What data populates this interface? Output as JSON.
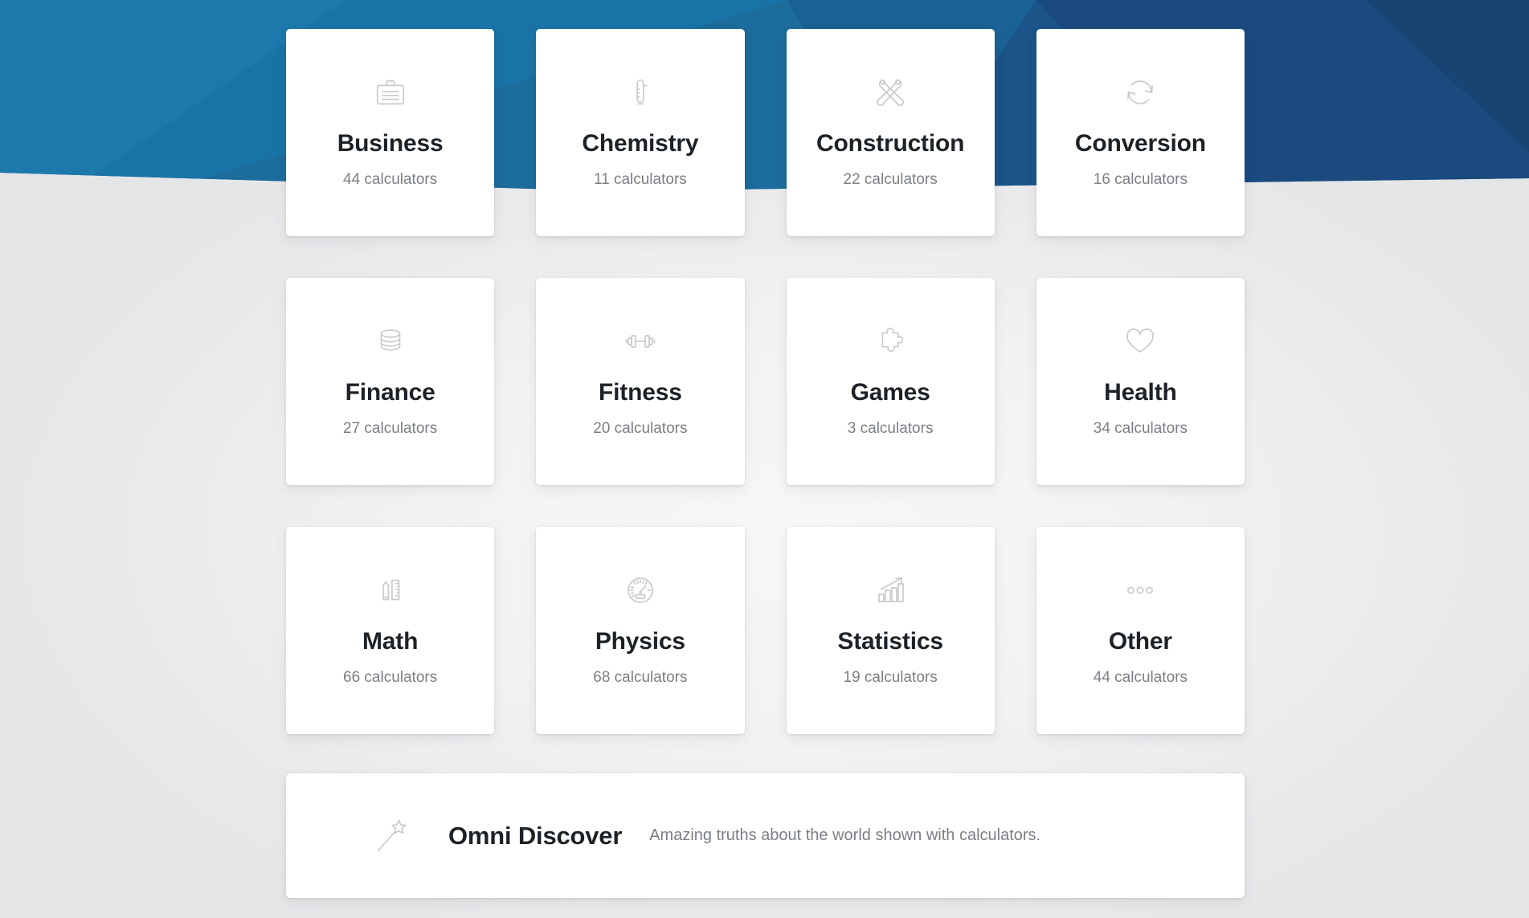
{
  "banner": {
    "name": "hero-banner",
    "colors": {
      "light_teal_blue": "#1b7aab",
      "mid_blue": "#1d6fa3",
      "steel_blue": "#19699c",
      "deep_blue": "#19558c",
      "navy": "#1a4a7e",
      "dark_navy": "#16406e"
    }
  },
  "theme": {
    "page_background": "#eceded",
    "card_background": "#ffffff",
    "title_color": "#1d2227",
    "muted_text_color": "#7b7f85",
    "icon_color": "#c9cacc"
  },
  "categories": [
    [
      {
        "title": "Business",
        "count": "44 calculators",
        "icon": "briefcase-icon"
      },
      {
        "title": "Chemistry",
        "count": "11 calculators",
        "icon": "thermometer-icon"
      },
      {
        "title": "Construction",
        "count": "22 calculators",
        "icon": "crossed-wrenches-icon"
      },
      {
        "title": "Conversion",
        "count": "16 calculators",
        "icon": "refresh-arrows-icon"
      }
    ],
    [
      {
        "title": "Finance",
        "count": "27 calculators",
        "icon": "coin-stack-icon"
      },
      {
        "title": "Fitness",
        "count": "20 calculators",
        "icon": "dumbbell-icon"
      },
      {
        "title": "Games",
        "count": "3 calculators",
        "icon": "puzzle-piece-icon"
      },
      {
        "title": "Health",
        "count": "34 calculators",
        "icon": "heart-icon"
      }
    ],
    [
      {
        "title": "Math",
        "count": "66 calculators",
        "icon": "pencil-ruler-icon"
      },
      {
        "title": "Physics",
        "count": "68 calculators",
        "icon": "speedometer-icon"
      },
      {
        "title": "Statistics",
        "count": "19 calculators",
        "icon": "bar-chart-arrow-icon"
      },
      {
        "title": "Other",
        "count": "44 calculators",
        "icon": "three-circles-icon"
      }
    ]
  ],
  "discover": {
    "icon": "magic-wand-icon",
    "title": "Omni Discover",
    "subtitle": "Amazing truths about the world shown with calculators."
  }
}
